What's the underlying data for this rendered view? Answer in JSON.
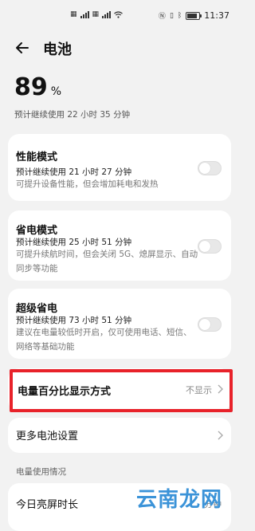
{
  "status_bar": {
    "left_icons": [
      "sim-1-icon",
      "hd-icon",
      "signal-icon",
      "sim-2-icon",
      "signal-icon",
      "wifi-icon"
    ],
    "right_icons": [
      "nfc-icon",
      "vibrate-icon",
      "bluetooth-icon",
      "battery-icon"
    ],
    "time": "11:37"
  },
  "header": {
    "title": "电池"
  },
  "battery": {
    "level": "89",
    "percent_sign": "%",
    "remaining": "预计继续使用 22 小时 35 分钟"
  },
  "modes": [
    {
      "title": "性能模式",
      "estimate": "预计继续使用 21 小时 27 分钟",
      "desc": "可提升设备性能，但会增加耗电和发热",
      "enabled": false
    },
    {
      "title": "省电模式",
      "estimate": "预计继续使用 25 小时 51 分钟",
      "desc": "可提升续航时间，但会关闭 5G、熄屏显示、自动同步等功能",
      "enabled": false
    },
    {
      "title": "超级省电",
      "estimate": "预计继续使用 73 小时 51 分钟",
      "desc": "建议在电量较低时开启，仅可使用电话、短信、网络等基础功能",
      "enabled": false
    }
  ],
  "percent_display": {
    "title": "电量百分比显示方式",
    "value": "不显示"
  },
  "more_settings": {
    "title": "更多电池设置"
  },
  "usage": {
    "section_label": "电量使用情况",
    "screen_on_title": "今日亮屏时长",
    "screen_on_value": "分钟"
  },
  "watermark": {
    "text": "云南龙网"
  },
  "colors": {
    "background": "#f2f2f2",
    "card": "#ffffff",
    "highlight": "#e8222a",
    "watermark": "#3b93d8"
  }
}
